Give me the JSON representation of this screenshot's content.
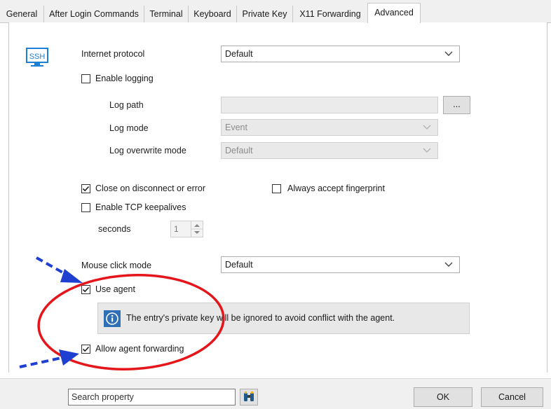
{
  "tabs": [
    {
      "label": "General"
    },
    {
      "label": "After Login Commands"
    },
    {
      "label": "Terminal"
    },
    {
      "label": "Keyboard"
    },
    {
      "label": "Private Key"
    },
    {
      "label": "X11 Forwarding"
    },
    {
      "label": "Advanced",
      "active": true
    }
  ],
  "ssh_icon_label": "SSH",
  "internet_protocol": {
    "label": "Internet protocol",
    "value": "Default"
  },
  "enable_logging": {
    "label": "Enable logging",
    "checked": false
  },
  "log_path": {
    "label": "Log path",
    "value": "",
    "browse_label": "..."
  },
  "log_mode": {
    "label": "Log mode",
    "value": "Event"
  },
  "log_overwrite_mode": {
    "label": "Log overwrite mode",
    "value": "Default"
  },
  "close_on_disconnect": {
    "label": "Close on disconnect or error",
    "checked": true
  },
  "always_accept_fingerprint": {
    "label": "Always accept fingerprint",
    "checked": false
  },
  "enable_tcp_keepalives": {
    "label": "Enable TCP keepalives",
    "checked": false
  },
  "seconds": {
    "label": "seconds",
    "value": "1"
  },
  "mouse_click_mode": {
    "label": "Mouse click mode",
    "value": "Default"
  },
  "use_agent": {
    "label": "Use agent",
    "checked": true
  },
  "info_message": "The entry's private key will be ignored to avoid conflict with the agent.",
  "allow_agent_forwarding": {
    "label": "Allow agent forwarding",
    "checked": true
  },
  "search": {
    "placeholder": "Search property"
  },
  "buttons": {
    "ok": "OK",
    "cancel": "Cancel"
  },
  "colors": {
    "annotation_circle": "#e4161b",
    "annotation_arrow": "#1f3fd1",
    "info_icon": "#2f6fb6",
    "ssh_icon": "#1e7fd6"
  }
}
